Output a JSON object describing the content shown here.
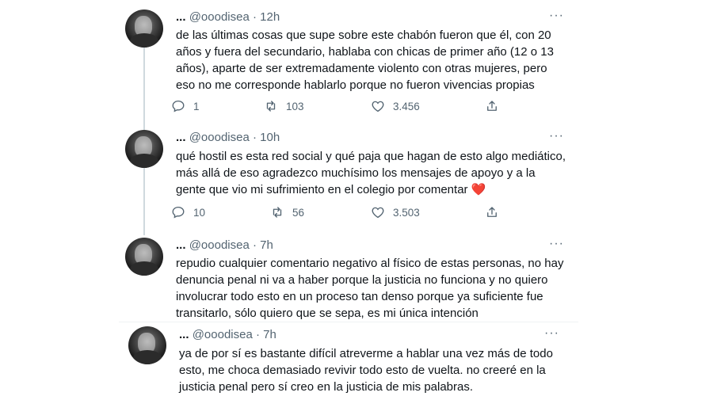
{
  "tweets": [
    {
      "name": "...",
      "handle": "@ooodisea",
      "time": "12h",
      "text": "de las últimas cosas que supe sobre este chabón fueron que él, con 20 años y fuera del secundario, hablaba con chicas de primer año (12 o 13 años), aparte de ser extremadamente violento con otras mujeres, pero eso no me corresponde hablarlo porque no fueron vivencias propias",
      "replies": "1",
      "retweets": "103",
      "likes": "3.456"
    },
    {
      "name": "...",
      "handle": "@ooodisea",
      "time": "10h",
      "text": "qué hostil es esta red social y qué paja que hagan de esto algo mediático, más allá de eso agradezco muchísimo los mensajes de apoyo y a la gente que vio mi sufrimiento en el colegio por comentar",
      "emoji": "❤️",
      "replies": "10",
      "retweets": "56",
      "likes": "3.503"
    },
    {
      "name": "...",
      "handle": "@ooodisea",
      "time": "7h",
      "text": "repudio cualquier comentario negativo al físico de estas personas, no hay denuncia penal ni va a haber porque la justicia no funciona y no quiero involucrar todo esto en un proceso tan denso porque ya suficiente fue transitarlo, sólo quiero que se sepa, es mi única intención"
    },
    {
      "name": "...",
      "handle": "@ooodisea",
      "time": "7h",
      "text": "ya de por sí es bastante difícil atreverme a hablar una vez más de todo esto, me choca demasiado revivir todo esto de vuelta. no creeré en la justicia penal pero sí creo en la justicia de mis palabras."
    }
  ],
  "separator": " · ",
  "more_glyph": "···",
  "icons": {
    "reply": "reply-icon",
    "retweet": "retweet-icon",
    "like": "heart-icon",
    "share": "share-icon",
    "more": "more-icon"
  },
  "colors": {
    "text": "#0f1419",
    "secondary": "#536471",
    "heart_emoji": "#e0245e"
  }
}
